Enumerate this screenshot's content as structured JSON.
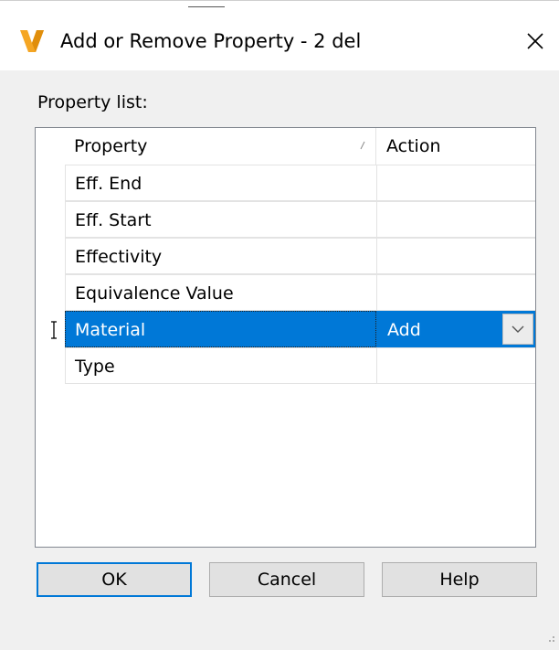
{
  "window": {
    "title": "Add or Remove Property - 2 del",
    "app_icon": "vault-v-logo-icon",
    "close_icon": "close-icon"
  },
  "property_list": {
    "label": "Property list:",
    "columns": {
      "property": "Property",
      "action": "Action"
    },
    "sort_icon": "sort-indicator-icon",
    "rows": [
      {
        "property": "Eff. End",
        "action": ""
      },
      {
        "property": "Eff. Start",
        "action": ""
      },
      {
        "property": "Effectivity",
        "action": ""
      },
      {
        "property": "Equivalence Value",
        "action": ""
      },
      {
        "property": "Material",
        "action": "Add",
        "selected": true
      },
      {
        "property": "Type",
        "action": ""
      }
    ]
  },
  "buttons": {
    "ok": "OK",
    "cancel": "Cancel",
    "help": "Help"
  },
  "colors": {
    "selection": "#0078d7",
    "dialog_bg": "#f0f0f0",
    "logo": "#f5a623"
  }
}
